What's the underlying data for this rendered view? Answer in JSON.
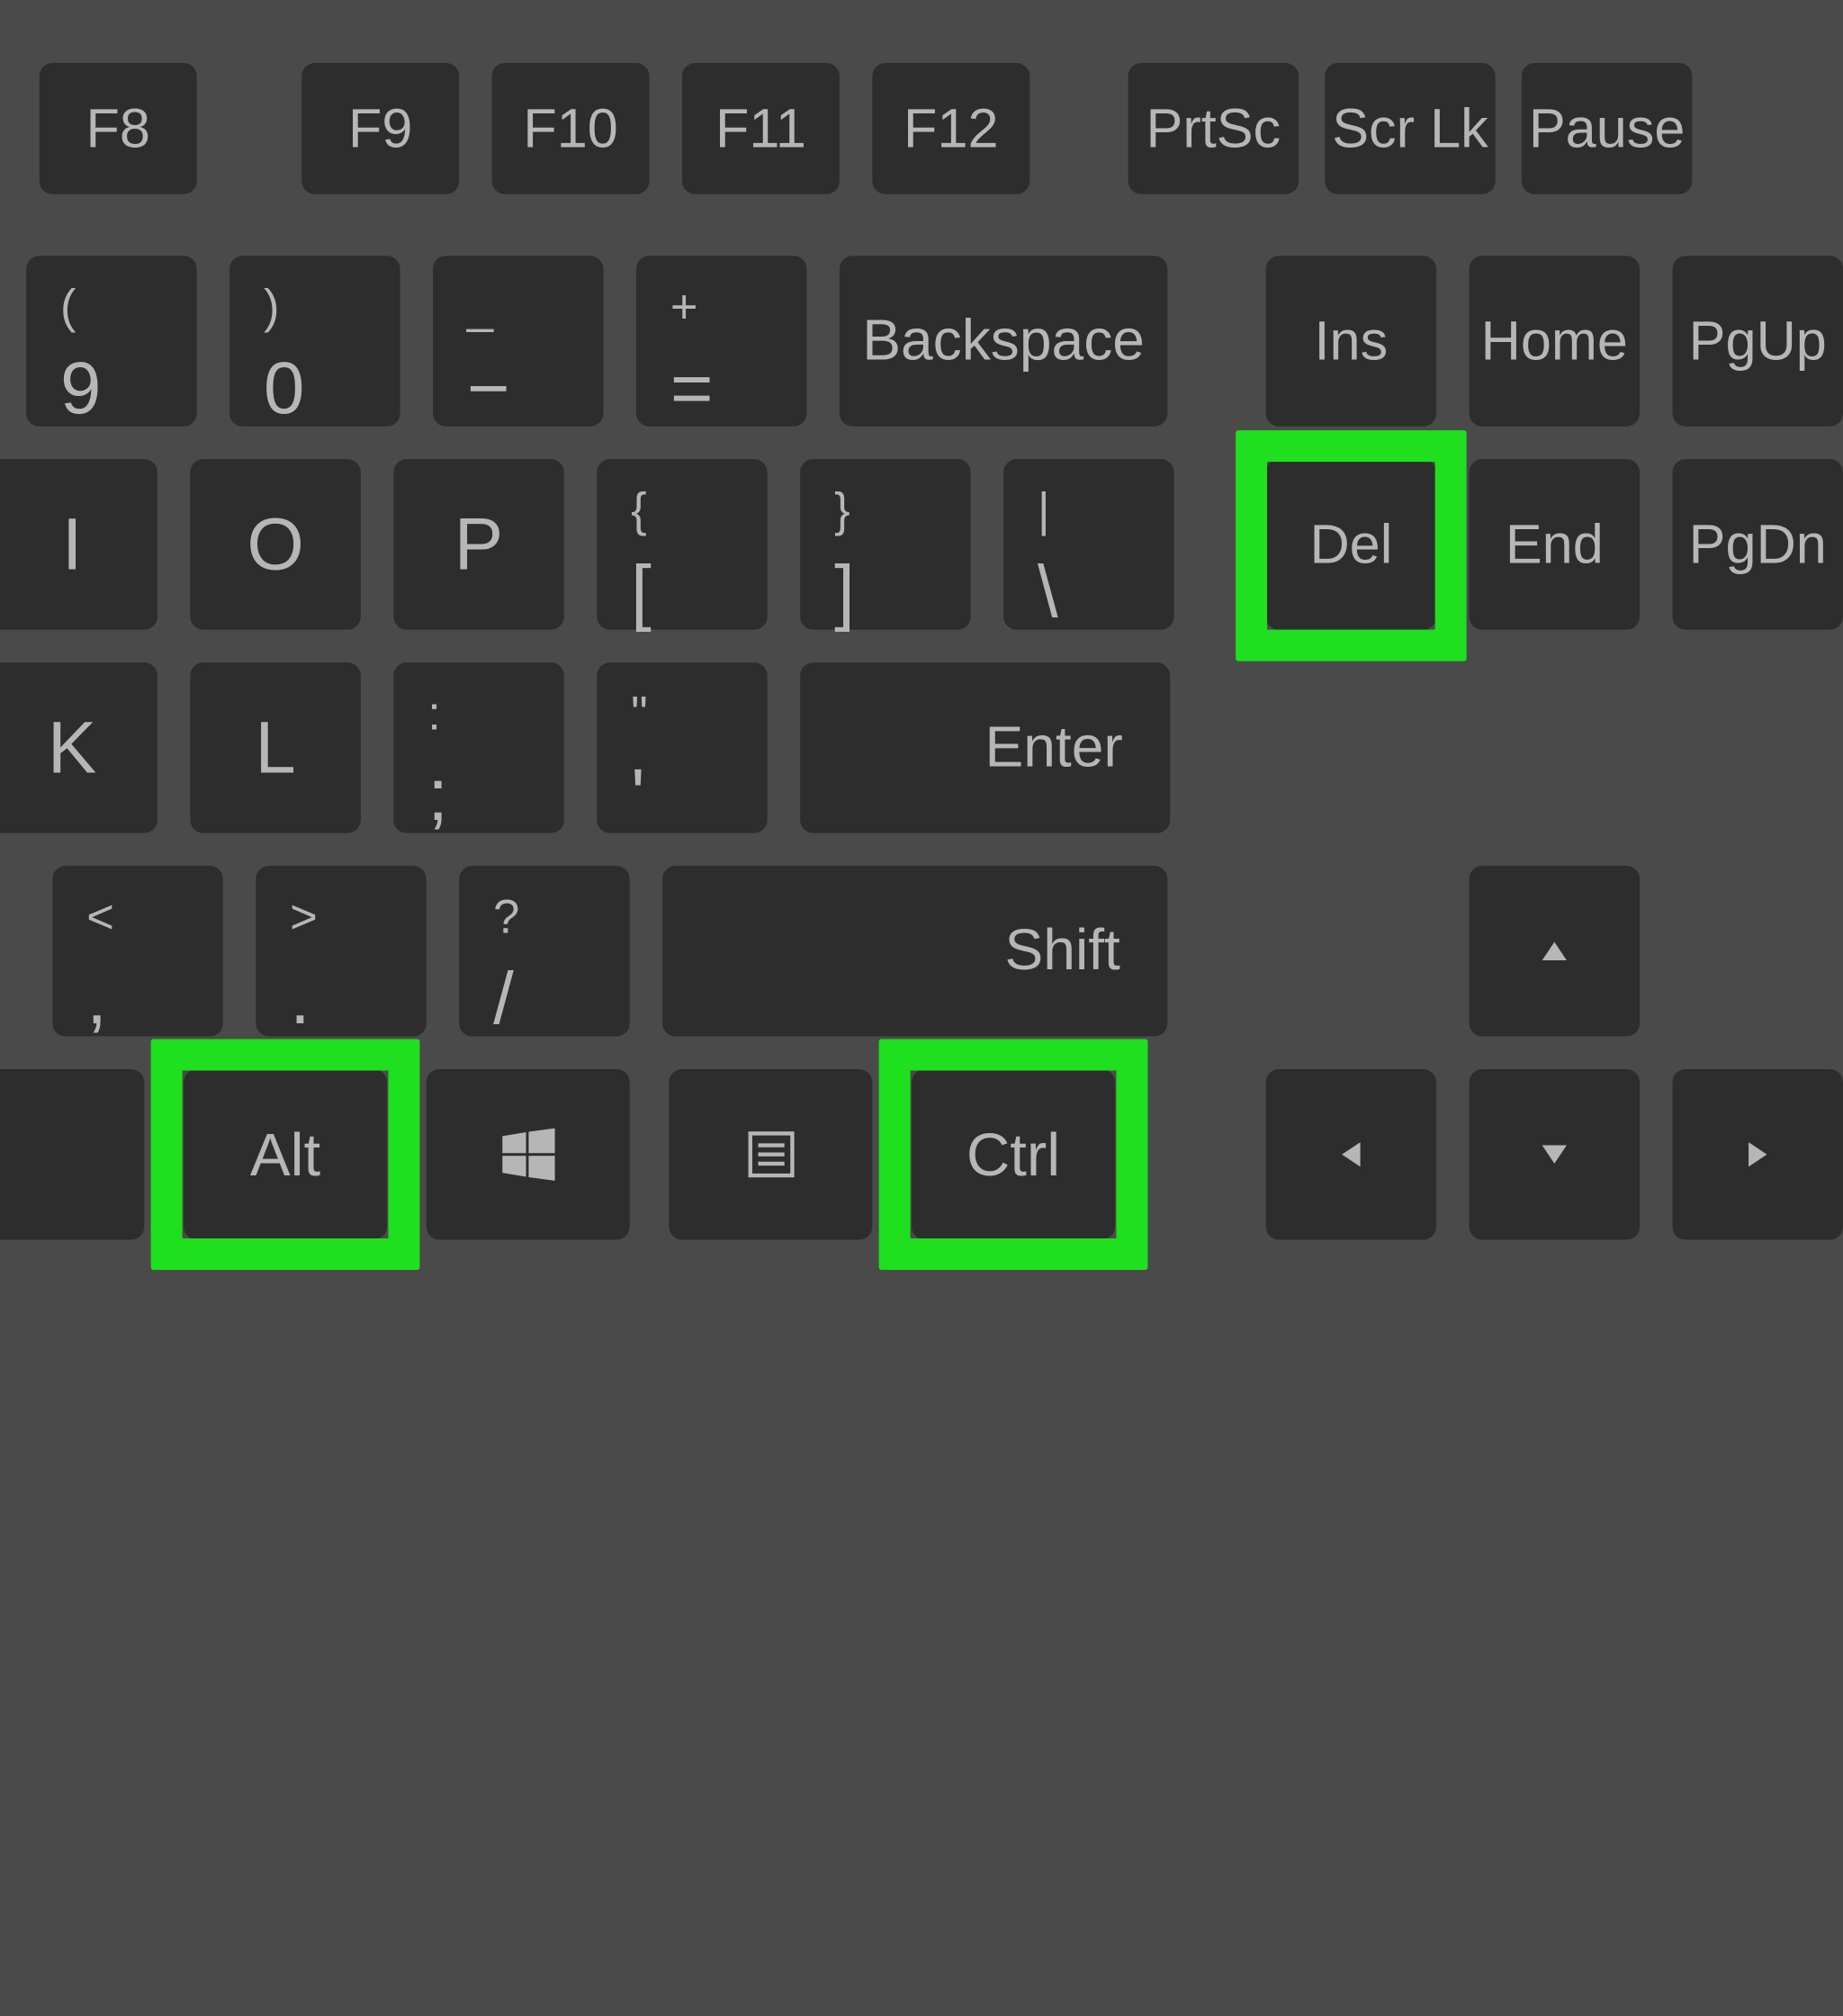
{
  "row_function": {
    "f8": "F8",
    "f9": "F9",
    "f10": "F10",
    "f11": "F11",
    "f12": "F12",
    "prtsc": "PrtSc",
    "scrlk": "Scr Lk",
    "pause": "Pause"
  },
  "row_number": {
    "k9_top": "(",
    "k9_bot": "9",
    "k0_top": ")",
    "k0_bot": "0",
    "minus_top": "_",
    "minus_bot": "−",
    "equal_top": "+",
    "equal_bot": "=",
    "backspace": "Backspace",
    "ins": "Ins",
    "home": "Home",
    "pgup": "PgUp"
  },
  "row_qwerty": {
    "i": "I",
    "o": "O",
    "p": "P",
    "lbracket_top": "{",
    "lbracket_bot": "[",
    "rbracket_top": "}",
    "rbracket_bot": "]",
    "bslash_top": "|",
    "bslash_bot": "\\",
    "del": "Del",
    "end": "End",
    "pgdn": "PgDn"
  },
  "row_home": {
    "k": "K",
    "l": "L",
    "semi_top": ":",
    "semi_bot": ";",
    "quote_top": "\"",
    "quote_bot": "'",
    "enter": "Enter"
  },
  "row_shift": {
    "comma_top": "<",
    "comma_bot": ",",
    "period_top": ">",
    "period_bot": ".",
    "slash_top": "?",
    "slash_bot": "/",
    "shift": "Shift"
  },
  "row_bottom": {
    "alt": "Alt",
    "ctrl": "Ctrl"
  },
  "highlights": [
    "del",
    "alt",
    "ctrl"
  ],
  "colors": {
    "highlight": "#1ee01e",
    "key_bg": "#2d2d2d",
    "bg": "#4a4a4a",
    "text": "#b6b6b6"
  }
}
